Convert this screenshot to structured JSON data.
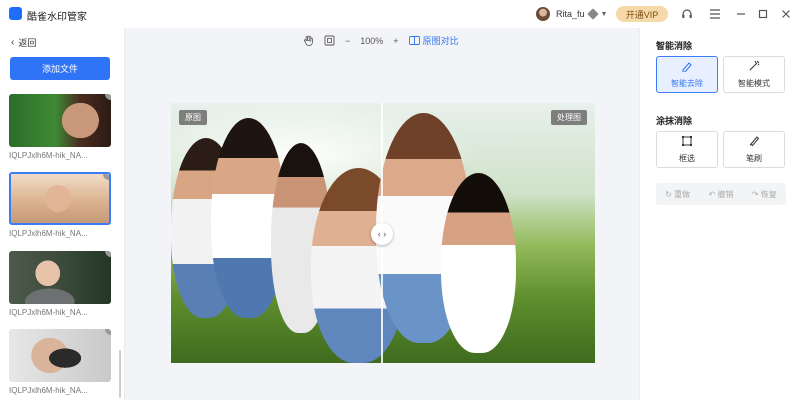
{
  "app": {
    "title": "酷雀水印管家"
  },
  "user": {
    "name": "Rita_fu"
  },
  "header": {
    "vip_label": "开通VIP"
  },
  "sidebar": {
    "back_label": "返回",
    "add_file_label": "添加文件",
    "files": [
      {
        "name": "IQLPJxlh6M-hik_NA..."
      },
      {
        "name": "IQLPJxlh6M-hik_NA..."
      },
      {
        "name": "IQLPJxlh6M-hik_NA..."
      },
      {
        "name": "IQLPJxlh6M-hik_NA..."
      }
    ]
  },
  "toolbar": {
    "zoom": "100%",
    "compare_label": "原图对比"
  },
  "canvas": {
    "original_tag": "原图",
    "processed_tag": "处理图"
  },
  "panel": {
    "smart_title": "智能消除",
    "smart_remove": "智能去除",
    "smart_mode": "智能模式",
    "brush_title": "涂抹消除",
    "box_select": "框选",
    "brush": "笔刷",
    "redo": "重做",
    "undo": "撤销",
    "restore": "恢复"
  },
  "colors": {
    "accent": "#2f74f6",
    "vip": "#f6d9a8"
  }
}
